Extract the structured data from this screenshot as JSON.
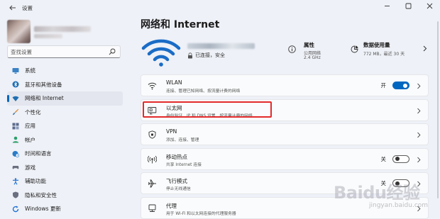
{
  "app": {
    "title": "设置"
  },
  "window_controls": [
    "minimize",
    "maximize",
    "close"
  ],
  "search": {
    "placeholder": "查找设置"
  },
  "sidebar": {
    "items": [
      {
        "label": "系统",
        "icon": "monitor-icon",
        "color": "#3b82c4"
      },
      {
        "label": "蓝牙和其他设备",
        "icon": "bluetooth-icon",
        "color": "#1f6fb2"
      },
      {
        "label": "网络和 Internet",
        "icon": "wifi-icon",
        "color": "#1f6fb2",
        "active": true
      },
      {
        "label": "个性化",
        "icon": "brush-icon",
        "color": "#d9822b"
      },
      {
        "label": "应用",
        "icon": "apps-icon",
        "color": "#5a6b8c"
      },
      {
        "label": "帐户",
        "icon": "person-icon",
        "color": "#2e9e6a"
      },
      {
        "label": "时间和语言",
        "icon": "globe-clock-icon",
        "color": "#2a7cc7"
      },
      {
        "label": "游戏",
        "icon": "gamepad-icon",
        "color": "#6b7080"
      },
      {
        "label": "辅助功能",
        "icon": "accessibility-icon",
        "color": "#1d6fd1"
      },
      {
        "label": "隐私和安全性",
        "icon": "shield-icon",
        "color": "#6b7080"
      },
      {
        "label": "Windows 更新",
        "icon": "update-icon",
        "color": "#1d6fd1"
      }
    ]
  },
  "main": {
    "title": "网络和 Internet",
    "status": "已连接，安全",
    "properties": {
      "title": "属性",
      "line1": "公用网络",
      "line2": "2.4 GHz"
    },
    "data_usage": {
      "title": "数据使用量",
      "line1": "772 MB，最近 30 天"
    },
    "cards": [
      {
        "title": "WLAN",
        "desc": "连接、管理已知网络、按流量计费的网络",
        "icon": "wifi-small-icon",
        "toggle": "on",
        "toggle_label": "开"
      },
      {
        "title": "以太网",
        "desc": "身份验证、IP 和 DNS 设置、按流量计费的网络",
        "icon": "ethernet-icon"
      },
      {
        "title": "VPN",
        "desc": "添加、连接、管理",
        "icon": "vpn-shield-icon"
      },
      {
        "title": "移动热点",
        "desc": "共享 Internet 连接",
        "icon": "hotspot-icon",
        "toggle": "off",
        "toggle_label": "关"
      },
      {
        "title": "飞行模式",
        "desc": "停止无线通信",
        "icon": "airplane-icon",
        "toggle": "off",
        "toggle_label": "关"
      },
      {
        "title": "代理",
        "desc": "用于 Wi-Fi 和以太网连接的代理服务器",
        "icon": "proxy-icon"
      }
    ]
  },
  "watermark": {
    "main": "Baidu经验",
    "sub": "jingyan.baidu.com"
  },
  "colors": {
    "accent": "#0067c0",
    "highlight": "#e32b2b",
    "background": "#eef1f7"
  }
}
